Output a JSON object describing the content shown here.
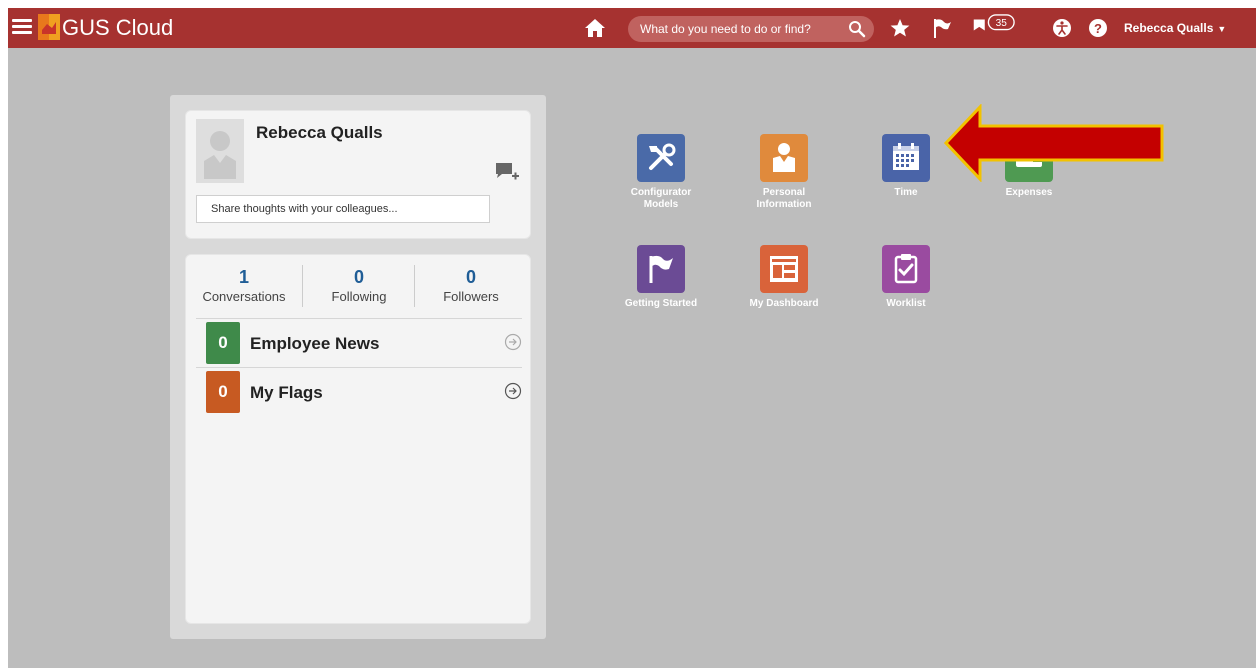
{
  "topbar": {
    "title": "GUS Cloud",
    "search_placeholder": "What do you need to do or find?",
    "notification_count": "35",
    "user_name": "Rebecca Qualls",
    "colors": {
      "bar": "#a63230",
      "search": "#c0625f"
    }
  },
  "profile": {
    "name": "Rebecca Qualls",
    "share_placeholder": "Share thoughts with your colleagues..."
  },
  "stats": [
    {
      "value": "1",
      "label": "Conversations"
    },
    {
      "value": "0",
      "label": "Following"
    },
    {
      "value": "0",
      "label": "Followers"
    }
  ],
  "feed": [
    {
      "count": "0",
      "label": "Employee News",
      "color": "#3f8a4a",
      "icon": "circle-arrow-right-icon"
    },
    {
      "count": "0",
      "label": "My Flags",
      "color": "#c75a22",
      "icon": "circle-arrow-right-icon"
    }
  ],
  "tiles": [
    {
      "label_line1": "Configurator",
      "label_line2": "Models",
      "color": "#4a6aa8",
      "icon": "tools-icon"
    },
    {
      "label_line1": "Personal",
      "label_line2": "Information",
      "color": "#e08a3c",
      "icon": "person-badge-icon"
    },
    {
      "label_line1": "Time",
      "label_line2": "",
      "color": "#4a64a8",
      "icon": "calendar-icon"
    },
    {
      "label_line1": "Expenses",
      "label_line2": "",
      "color": "#4f9a52",
      "icon": "wallet-icon"
    },
    {
      "label_line1": "Getting Started",
      "label_line2": "",
      "color": "#6b4b95",
      "icon": "flag-icon"
    },
    {
      "label_line1": "My Dashboard",
      "label_line2": "",
      "color": "#d9633a",
      "icon": "dashboard-icon"
    },
    {
      "label_line1": "Worklist",
      "label_line2": "",
      "color": "#9a4ba0",
      "icon": "clipboard-check-icon"
    }
  ],
  "annotation": {
    "color": "#c40000",
    "outline": "#f2c200",
    "icon": "red-arrow-pointing-left"
  }
}
